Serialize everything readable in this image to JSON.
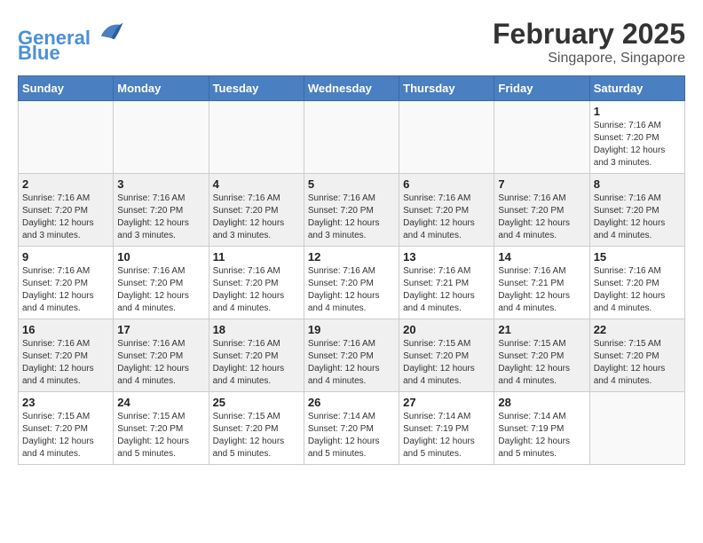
{
  "logo": {
    "line1": "General",
    "line2": "Blue"
  },
  "title": "February 2025",
  "subtitle": "Singapore, Singapore",
  "days_of_week": [
    "Sunday",
    "Monday",
    "Tuesday",
    "Wednesday",
    "Thursday",
    "Friday",
    "Saturday"
  ],
  "weeks": [
    [
      {
        "day": "",
        "info": ""
      },
      {
        "day": "",
        "info": ""
      },
      {
        "day": "",
        "info": ""
      },
      {
        "day": "",
        "info": ""
      },
      {
        "day": "",
        "info": ""
      },
      {
        "day": "",
        "info": ""
      },
      {
        "day": "1",
        "info": "Sunrise: 7:16 AM\nSunset: 7:20 PM\nDaylight: 12 hours\nand 3 minutes."
      }
    ],
    [
      {
        "day": "2",
        "info": "Sunrise: 7:16 AM\nSunset: 7:20 PM\nDaylight: 12 hours\nand 3 minutes."
      },
      {
        "day": "3",
        "info": "Sunrise: 7:16 AM\nSunset: 7:20 PM\nDaylight: 12 hours\nand 3 minutes."
      },
      {
        "day": "4",
        "info": "Sunrise: 7:16 AM\nSunset: 7:20 PM\nDaylight: 12 hours\nand 3 minutes."
      },
      {
        "day": "5",
        "info": "Sunrise: 7:16 AM\nSunset: 7:20 PM\nDaylight: 12 hours\nand 3 minutes."
      },
      {
        "day": "6",
        "info": "Sunrise: 7:16 AM\nSunset: 7:20 PM\nDaylight: 12 hours\nand 4 minutes."
      },
      {
        "day": "7",
        "info": "Sunrise: 7:16 AM\nSunset: 7:20 PM\nDaylight: 12 hours\nand 4 minutes."
      },
      {
        "day": "8",
        "info": "Sunrise: 7:16 AM\nSunset: 7:20 PM\nDaylight: 12 hours\nand 4 minutes."
      }
    ],
    [
      {
        "day": "9",
        "info": "Sunrise: 7:16 AM\nSunset: 7:20 PM\nDaylight: 12 hours\nand 4 minutes."
      },
      {
        "day": "10",
        "info": "Sunrise: 7:16 AM\nSunset: 7:20 PM\nDaylight: 12 hours\nand 4 minutes."
      },
      {
        "day": "11",
        "info": "Sunrise: 7:16 AM\nSunset: 7:20 PM\nDaylight: 12 hours\nand 4 minutes."
      },
      {
        "day": "12",
        "info": "Sunrise: 7:16 AM\nSunset: 7:20 PM\nDaylight: 12 hours\nand 4 minutes."
      },
      {
        "day": "13",
        "info": "Sunrise: 7:16 AM\nSunset: 7:21 PM\nDaylight: 12 hours\nand 4 minutes."
      },
      {
        "day": "14",
        "info": "Sunrise: 7:16 AM\nSunset: 7:21 PM\nDaylight: 12 hours\nand 4 minutes."
      },
      {
        "day": "15",
        "info": "Sunrise: 7:16 AM\nSunset: 7:20 PM\nDaylight: 12 hours\nand 4 minutes."
      }
    ],
    [
      {
        "day": "16",
        "info": "Sunrise: 7:16 AM\nSunset: 7:20 PM\nDaylight: 12 hours\nand 4 minutes."
      },
      {
        "day": "17",
        "info": "Sunrise: 7:16 AM\nSunset: 7:20 PM\nDaylight: 12 hours\nand 4 minutes."
      },
      {
        "day": "18",
        "info": "Sunrise: 7:16 AM\nSunset: 7:20 PM\nDaylight: 12 hours\nand 4 minutes."
      },
      {
        "day": "19",
        "info": "Sunrise: 7:16 AM\nSunset: 7:20 PM\nDaylight: 12 hours\nand 4 minutes."
      },
      {
        "day": "20",
        "info": "Sunrise: 7:15 AM\nSunset: 7:20 PM\nDaylight: 12 hours\nand 4 minutes."
      },
      {
        "day": "21",
        "info": "Sunrise: 7:15 AM\nSunset: 7:20 PM\nDaylight: 12 hours\nand 4 minutes."
      },
      {
        "day": "22",
        "info": "Sunrise: 7:15 AM\nSunset: 7:20 PM\nDaylight: 12 hours\nand 4 minutes."
      }
    ],
    [
      {
        "day": "23",
        "info": "Sunrise: 7:15 AM\nSunset: 7:20 PM\nDaylight: 12 hours\nand 4 minutes."
      },
      {
        "day": "24",
        "info": "Sunrise: 7:15 AM\nSunset: 7:20 PM\nDaylight: 12 hours\nand 5 minutes."
      },
      {
        "day": "25",
        "info": "Sunrise: 7:15 AM\nSunset: 7:20 PM\nDaylight: 12 hours\nand 5 minutes."
      },
      {
        "day": "26",
        "info": "Sunrise: 7:14 AM\nSunset: 7:20 PM\nDaylight: 12 hours\nand 5 minutes."
      },
      {
        "day": "27",
        "info": "Sunrise: 7:14 AM\nSunset: 7:19 PM\nDaylight: 12 hours\nand 5 minutes."
      },
      {
        "day": "28",
        "info": "Sunrise: 7:14 AM\nSunset: 7:19 PM\nDaylight: 12 hours\nand 5 minutes."
      },
      {
        "day": "",
        "info": ""
      }
    ]
  ]
}
